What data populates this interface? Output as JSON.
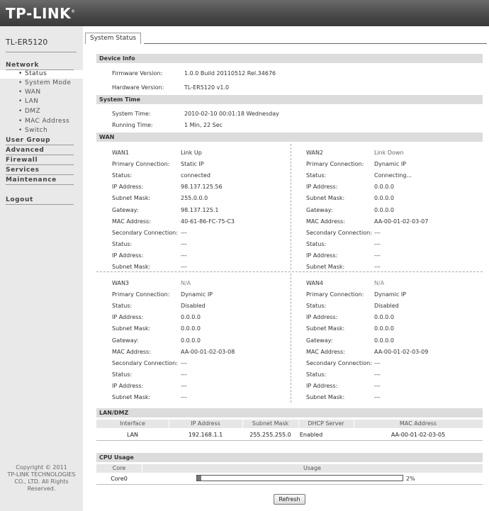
{
  "brand": {
    "logo": "TP-LINK",
    "reg_mark": "®"
  },
  "sidebar": {
    "model": "TL-ER5120",
    "network": "Network",
    "network_items": [
      "• Status",
      "• System Mode",
      "• WAN",
      "• LAN",
      "• DMZ",
      "• MAC Address",
      "• Switch"
    ],
    "groups": [
      "User Group",
      "Advanced",
      "Firewall",
      "Services",
      "Maintenance"
    ],
    "logout": "Logout",
    "copyright": [
      "Copyright © 2011",
      "TP-LINK TECHNOLOGIES",
      "CO., LTD. All Rights",
      "Reserved."
    ]
  },
  "tab": {
    "label": "System Status"
  },
  "device_info": {
    "heading": "Device Info",
    "firmware_label": "Firmware Version:",
    "firmware_value": "1.0.0 Build 20110512 Rel.34676",
    "hardware_label": "Hardware Version:",
    "hardware_value": "TL-ER5120 v1.0"
  },
  "system_time": {
    "heading": "System Time",
    "time_label": "System Time:",
    "time_value": "2010-02-10 00:01:18 Wednesday",
    "running_label": "Running Time:",
    "running_value": "1 Min, 22 Sec"
  },
  "wan": {
    "heading": "WAN",
    "labels": {
      "primary": "Primary Connection:",
      "status": "Status:",
      "ip": "IP Address:",
      "mask": "Subnet Mask:",
      "gateway": "Gateway:",
      "mac": "MAC Address:",
      "secondary": "Secondary Connection:"
    },
    "ports": [
      {
        "name": "WAN1",
        "link": "Link Up",
        "primary": "Static IP",
        "status": "connected",
        "ip": "98.137.125.56",
        "mask": "255.0.0.0",
        "gateway": "98.137.125.1",
        "mac": "40-61-86-FC-75-C3",
        "secondary": "---",
        "sec_status": "---",
        "sec_ip": "---",
        "sec_mask": "---"
      },
      {
        "name": "WAN2",
        "link": "Link Down",
        "primary": "Dynamic IP",
        "status": "Connecting...",
        "ip": "0.0.0.0",
        "mask": "0.0.0.0",
        "gateway": "0.0.0.0",
        "mac": "AA-00-01-02-03-07",
        "secondary": "---",
        "sec_status": "---",
        "sec_ip": "---",
        "sec_mask": "---"
      },
      {
        "name": "WAN3",
        "link": "N/A",
        "primary": "Dynamic IP",
        "status": "Disabled",
        "ip": "0.0.0.0",
        "mask": "0.0.0.0",
        "gateway": "0.0.0.0",
        "mac": "AA-00-01-02-03-08",
        "secondary": "---",
        "sec_status": "---",
        "sec_ip": "---",
        "sec_mask": "---"
      },
      {
        "name": "WAN4",
        "link": "N/A",
        "primary": "Dynamic IP",
        "status": "Disabled",
        "ip": "0.0.0.0",
        "mask": "0.0.0.0",
        "gateway": "0.0.0.0",
        "mac": "AA-00-01-02-03-09",
        "secondary": "---",
        "sec_status": "---",
        "sec_ip": "---",
        "sec_mask": "---"
      }
    ]
  },
  "lan": {
    "heading": "LAN/DMZ",
    "columns": [
      "Interface",
      "IP Address",
      "Subnet Mask",
      "DHCP Server",
      "MAC Address"
    ],
    "row": [
      "LAN",
      "192.168.1.1",
      "255.255.255.0",
      "Enabled",
      "AA-00-01-02-03-05"
    ]
  },
  "cpu": {
    "heading": "CPU Usage",
    "col_core": "Core",
    "col_usage": "Usage",
    "core_name": "Core0",
    "usage_text": "2%",
    "usage_fraction": 0.02
  },
  "refresh_label": "Refresh"
}
